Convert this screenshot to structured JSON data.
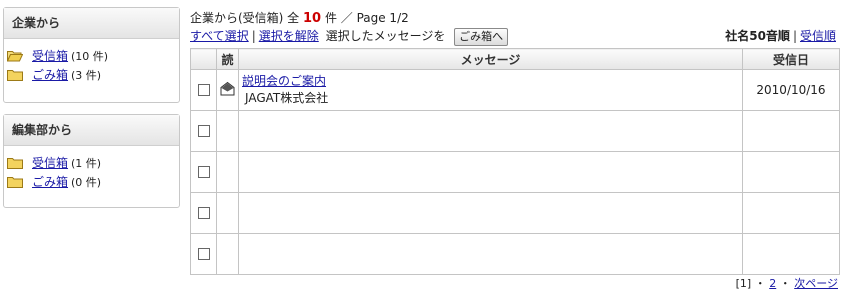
{
  "sidebar": {
    "company": {
      "title": "企業から",
      "items": [
        {
          "label": "受信箱",
          "count": "(10 件)",
          "open": true
        },
        {
          "label": "ごみ箱",
          "count": "(3 件)",
          "open": false
        }
      ]
    },
    "editorial": {
      "title": "編集部から",
      "items": [
        {
          "label": "受信箱",
          "count": "(1 件)",
          "open": false
        },
        {
          "label": "ごみ箱",
          "count": "(0 件)",
          "open": false
        }
      ]
    }
  },
  "summary": {
    "prefix": "企業から(受信箱) 全",
    "total": "10",
    "suffix": "件 ／ Page 1/2"
  },
  "toolbar": {
    "select_all": "すべて選択",
    "deselect": "選択を解除",
    "selected_text": "選択したメッセージを",
    "trash_button": "ごみ箱へ",
    "sort_company": "社名50音順",
    "sort_received": "受信順"
  },
  "table": {
    "headers": {
      "read": "読",
      "message": "メッセージ",
      "date": "受信日"
    },
    "rows": [
      {
        "subject": "説明会のご案内",
        "sender": "JAGAT株式会社",
        "date": "2010/10/16"
      },
      {
        "subject": "",
        "sender": "",
        "date": ""
      },
      {
        "subject": "",
        "sender": "",
        "date": ""
      },
      {
        "subject": "",
        "sender": "",
        "date": ""
      },
      {
        "subject": "",
        "sender": "",
        "date": ""
      }
    ]
  },
  "pager": {
    "current": "[1]",
    "page2": "2",
    "next": "次ページ"
  },
  "colors": {
    "accent_count": "#cc0000",
    "link": "#1a1aa6",
    "folder": "#e8c54a"
  }
}
